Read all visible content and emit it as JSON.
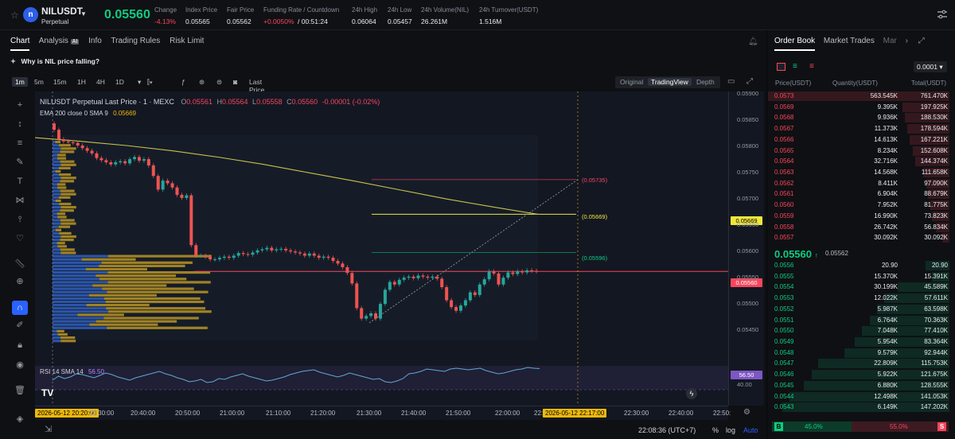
{
  "header": {
    "symbol": "NILUSDT",
    "contract_type": "Perpetual",
    "last_price": "0.05560",
    "stats": [
      {
        "label": "Change",
        "value": "-4.13%",
        "color": "red"
      },
      {
        "label": "Index Price",
        "value": "0.05565"
      },
      {
        "label": "Fair Price",
        "value": "0.05562"
      },
      {
        "label": "Funding Rate / Countdown",
        "value": "+0.0050%",
        "value2": "/ 00:51:24"
      },
      {
        "label": "24h High",
        "value": "0.06064"
      },
      {
        "label": "24h Low",
        "value": "0.05457"
      },
      {
        "label": "24h Volume(NIL)",
        "value": "26.261M"
      },
      {
        "label": "24h Turnover(USDT)",
        "value": "1.516M"
      }
    ]
  },
  "tabs": [
    "Chart",
    "Analysis",
    "Info",
    "Trading Rules",
    "Risk Limit"
  ],
  "analysis_badge": "AI",
  "banner": "Why is NIL price falling?",
  "toolbar": {
    "timeframes": [
      "1m",
      "5m",
      "15m",
      "1H",
      "4H",
      "1D"
    ],
    "price_type": "Last Price",
    "views": [
      "Original",
      "TradingView",
      "Depth"
    ]
  },
  "chart_legend": {
    "title": "NILUSDT Perpetual Last Price · 1 · MEXC",
    "ohlc": [
      {
        "k": "O",
        "v": "0.05561"
      },
      {
        "k": "H",
        "v": "0.05564"
      },
      {
        "k": "L",
        "v": "0.05558"
      },
      {
        "k": "C",
        "v": "0.05560"
      }
    ],
    "change": "-0.00001 (-0.02%)",
    "ema_label": "EMA 200 close 0 SMA 9",
    "ema_value": "0.05669"
  },
  "annotations": [
    "(0.05735)",
    "(0.05669)",
    "(0.05596)"
  ],
  "rsi": {
    "label": "RSI 14 SMA 14",
    "value": "56.50",
    "level": "40.00"
  },
  "price_scale_labels": {
    "ema": "0.05669",
    "last": "0.05560",
    "rsi": "56.50"
  },
  "chart_data": {
    "type": "candlestick",
    "y_ticks": [
      "0.05900",
      "0.05850",
      "0.05800",
      "0.05750",
      "0.05700",
      "0.05650",
      "0.05600",
      "0.05550",
      "0.05500",
      "0.05450"
    ],
    "ylim": [
      0.0543,
      0.059
    ],
    "x_ticks": [
      "2026-05-12 20:20:00",
      "20:30:00",
      "20:40:00",
      "20:50:00",
      "21:00:00",
      "21:10:00",
      "21:20:00",
      "21:30:00",
      "21:40:00",
      "21:50:00",
      "22:00:00",
      "22:10:00",
      "2026-05-12 22:17:00",
      "22:30:00",
      "22:40:00",
      "22:50:"
    ],
    "close": [
      0.0583,
      0.05812,
      0.05808,
      0.05806,
      0.05805,
      0.058,
      0.05795,
      0.0579,
      0.05785,
      0.05776,
      0.05772,
      0.05768,
      0.05764,
      0.05768,
      0.0577,
      0.05766,
      0.05774,
      0.05778,
      0.05771,
      0.05774,
      0.05762,
      0.05742,
      0.05716,
      0.05733,
      0.05728,
      0.0572,
      0.05706,
      0.057,
      0.05705,
      0.0561,
      0.0559,
      0.0559,
      0.05588,
      0.05583,
      0.05583,
      0.05586,
      0.05588,
      0.05586,
      0.0559,
      0.05595,
      0.05593,
      0.05592,
      0.05596,
      0.056,
      0.05602,
      0.05605,
      0.056,
      0.05602,
      0.05603,
      0.056,
      0.05598,
      0.05596,
      0.05594,
      0.0559,
      0.05594,
      0.0559,
      0.05586,
      0.05588,
      0.05586,
      0.0558,
      0.05575,
      0.05568,
      0.05557,
      0.05537,
      0.0549,
      0.0547,
      0.05475,
      0.0548,
      0.0547,
      0.05498,
      0.05525,
      0.0554,
      0.05535,
      0.05544,
      0.05548,
      0.0555,
      0.05547,
      0.05552,
      0.0555,
      0.05548,
      0.0555,
      0.05546,
      0.0553,
      0.05505,
      0.05492,
      0.05485,
      0.05495,
      0.05505,
      0.0552,
      0.05515,
      0.05535,
      0.05545,
      0.0556,
      0.05556,
      0.05535,
      0.05548,
      0.05558,
      0.05555,
      0.0556,
      0.05558,
      0.05562,
      0.05561,
      0.0556
    ],
    "ema200": [
      0.05815,
      0.05808,
      0.058,
      0.0579,
      0.05778,
      0.05764,
      0.05748,
      0.05732,
      0.05715,
      0.05698,
      0.05683,
      0.05669
    ],
    "volume_profile": "bid/ask volume profile bars on the left side of the chart",
    "rsi_values": [
      42,
      47,
      44,
      46,
      50,
      49,
      47,
      45,
      48,
      51,
      49,
      46,
      44,
      42,
      45,
      47,
      49,
      51,
      53,
      50,
      48,
      45,
      43,
      40,
      41,
      43,
      39,
      40,
      44,
      43,
      46,
      48,
      50,
      47,
      45,
      43,
      41,
      42,
      44,
      46,
      49,
      51,
      53,
      54,
      55,
      52,
      50,
      48,
      46,
      48,
      51,
      49,
      47,
      45,
      43,
      44,
      40,
      39,
      41,
      44,
      50,
      51,
      53,
      56,
      55,
      54,
      53,
      56,
      57,
      56,
      55,
      56,
      57,
      54,
      52,
      50,
      51,
      53,
      55,
      56,
      58,
      57,
      56.5
    ]
  },
  "bottom": {
    "time": "22:08:36 (UTC+7)",
    "options": [
      "%",
      "log",
      "Auto"
    ]
  },
  "orderbook": {
    "tabs": [
      "Order Book",
      "Market Trades",
      "Mar"
    ],
    "precision": "0.0001",
    "headers": [
      "Price(USDT)",
      "Quantity(USDT)",
      "Total(USDT)"
    ],
    "asks": [
      {
        "p": "0.0573",
        "q": "563.545K",
        "t": "761.470K"
      },
      {
        "p": "0.0569",
        "q": "9.395K",
        "t": "197.925K"
      },
      {
        "p": "0.0568",
        "q": "9.936K",
        "t": "188.530K"
      },
      {
        "p": "0.0567",
        "q": "11.373K",
        "t": "178.594K"
      },
      {
        "p": "0.0566",
        "q": "14.613K",
        "t": "167.221K"
      },
      {
        "p": "0.0565",
        "q": "8.234K",
        "t": "152.608K"
      },
      {
        "p": "0.0564",
        "q": "32.716K",
        "t": "144.374K"
      },
      {
        "p": "0.0563",
        "q": "14.568K",
        "t": "111.658K"
      },
      {
        "p": "0.0562",
        "q": "8.411K",
        "t": "97.090K"
      },
      {
        "p": "0.0561",
        "q": "6.904K",
        "t": "88.679K"
      },
      {
        "p": "0.0560",
        "q": "7.952K",
        "t": "81.775K"
      },
      {
        "p": "0.0559",
        "q": "16.990K",
        "t": "73.823K"
      },
      {
        "p": "0.0558",
        "q": "26.742K",
        "t": "56.834K"
      },
      {
        "p": "0.0557",
        "q": "30.092K",
        "t": "30.092K"
      }
    ],
    "mid_price": "0.05560",
    "mid_sub": "0.05562",
    "bids": [
      {
        "p": "0.0556",
        "q": "20.90",
        "t": "20.90"
      },
      {
        "p": "0.0555",
        "q": "15.370K",
        "t": "15.391K"
      },
      {
        "p": "0.0554",
        "q": "30.199K",
        "t": "45.589K"
      },
      {
        "p": "0.0553",
        "q": "12.022K",
        "t": "57.611K"
      },
      {
        "p": "0.0552",
        "q": "5.987K",
        "t": "63.598K"
      },
      {
        "p": "0.0551",
        "q": "6.764K",
        "t": "70.363K"
      },
      {
        "p": "0.0550",
        "q": "7.048K",
        "t": "77.410K"
      },
      {
        "p": "0.0549",
        "q": "5.954K",
        "t": "83.364K"
      },
      {
        "p": "0.0548",
        "q": "9.579K",
        "t": "92.944K"
      },
      {
        "p": "0.0547",
        "q": "22.809K",
        "t": "115.753K"
      },
      {
        "p": "0.0546",
        "q": "5.922K",
        "t": "121.675K"
      },
      {
        "p": "0.0545",
        "q": "6.880K",
        "t": "128.555K"
      },
      {
        "p": "0.0544",
        "q": "12.498K",
        "t": "141.053K"
      },
      {
        "p": "0.0543",
        "q": "6.149K",
        "t": "147.202K"
      }
    ],
    "ratio": {
      "b_label": "B",
      "b_pct": "45.0%",
      "s_label": "S",
      "s_pct": "55.0%",
      "b_share": 0.45
    }
  }
}
